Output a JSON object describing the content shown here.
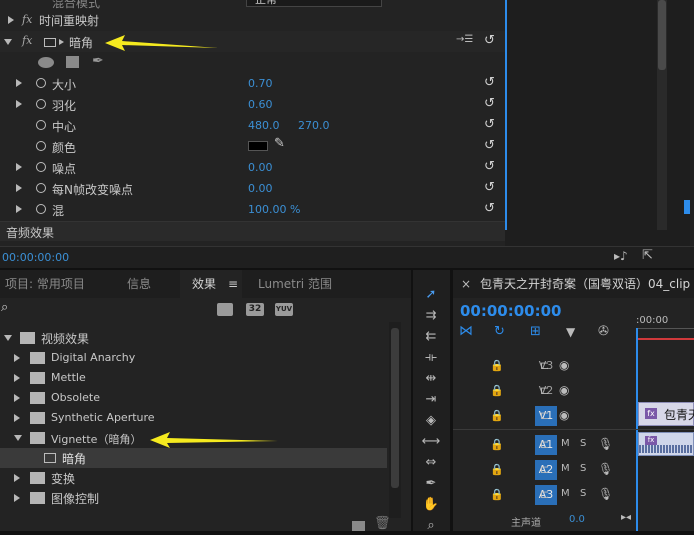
{
  "effect_controls": {
    "blend_mode_label": "混合模式",
    "blend_mode_value": "正常",
    "time_remap": "时间重映射",
    "vignette_effect": "暗角",
    "params": [
      {
        "label": "大小",
        "value": "0.70",
        "expandable": true
      },
      {
        "label": "羽化",
        "value": "0.60",
        "expandable": true
      },
      {
        "label": "中心",
        "value": "480.0",
        "value2": "270.0",
        "expandable": false
      },
      {
        "label": "颜色",
        "value": "",
        "expandable": false,
        "swatch": "#000000"
      },
      {
        "label": "噪点",
        "value": "0.00",
        "expandable": true
      },
      {
        "label": "每N帧改变噪点",
        "value": "0.00",
        "expandable": true
      },
      {
        "label": "混",
        "value": "100.00 %",
        "expandable": true
      }
    ],
    "audio_effects": "音频效果",
    "timecode": "00:00:00:00"
  },
  "project_panel": {
    "tabs": [
      "项目: 常用项目",
      "信息",
      "效果",
      "Lumetri 范围"
    ],
    "active_tab": "效果",
    "badges": [
      "32",
      "YUV"
    ],
    "tree": [
      {
        "label": "视频效果",
        "level": 0,
        "expanded": true
      },
      {
        "label": "Digital Anarchy",
        "level": 1,
        "expanded": false
      },
      {
        "label": "Mettle",
        "level": 1,
        "expanded": false
      },
      {
        "label": "Obsolete",
        "level": 1,
        "expanded": false
      },
      {
        "label": "Synthetic Aperture",
        "level": 1,
        "expanded": false
      },
      {
        "label": "Vignette（暗角）",
        "level": 1,
        "expanded": true
      },
      {
        "label": "暗角",
        "level": 2,
        "selected": true
      },
      {
        "label": "变换",
        "level": 1,
        "expanded": false
      },
      {
        "label": "图像控制",
        "level": 1,
        "expanded": false
      }
    ]
  },
  "timeline": {
    "sequence_name": "包青天之开封奇案（国粤双语）04_clip",
    "timecode": "00:00:00:00",
    "ruler_label": ":00:00",
    "video_tracks": [
      "V3",
      "V2",
      "V1"
    ],
    "audio_tracks": [
      "A1",
      "A2",
      "A3"
    ],
    "clip_label": "包青天",
    "audio_master_fragment": "主声道",
    "audio_master_value": "0.0",
    "accent": "#2d8ceb"
  }
}
